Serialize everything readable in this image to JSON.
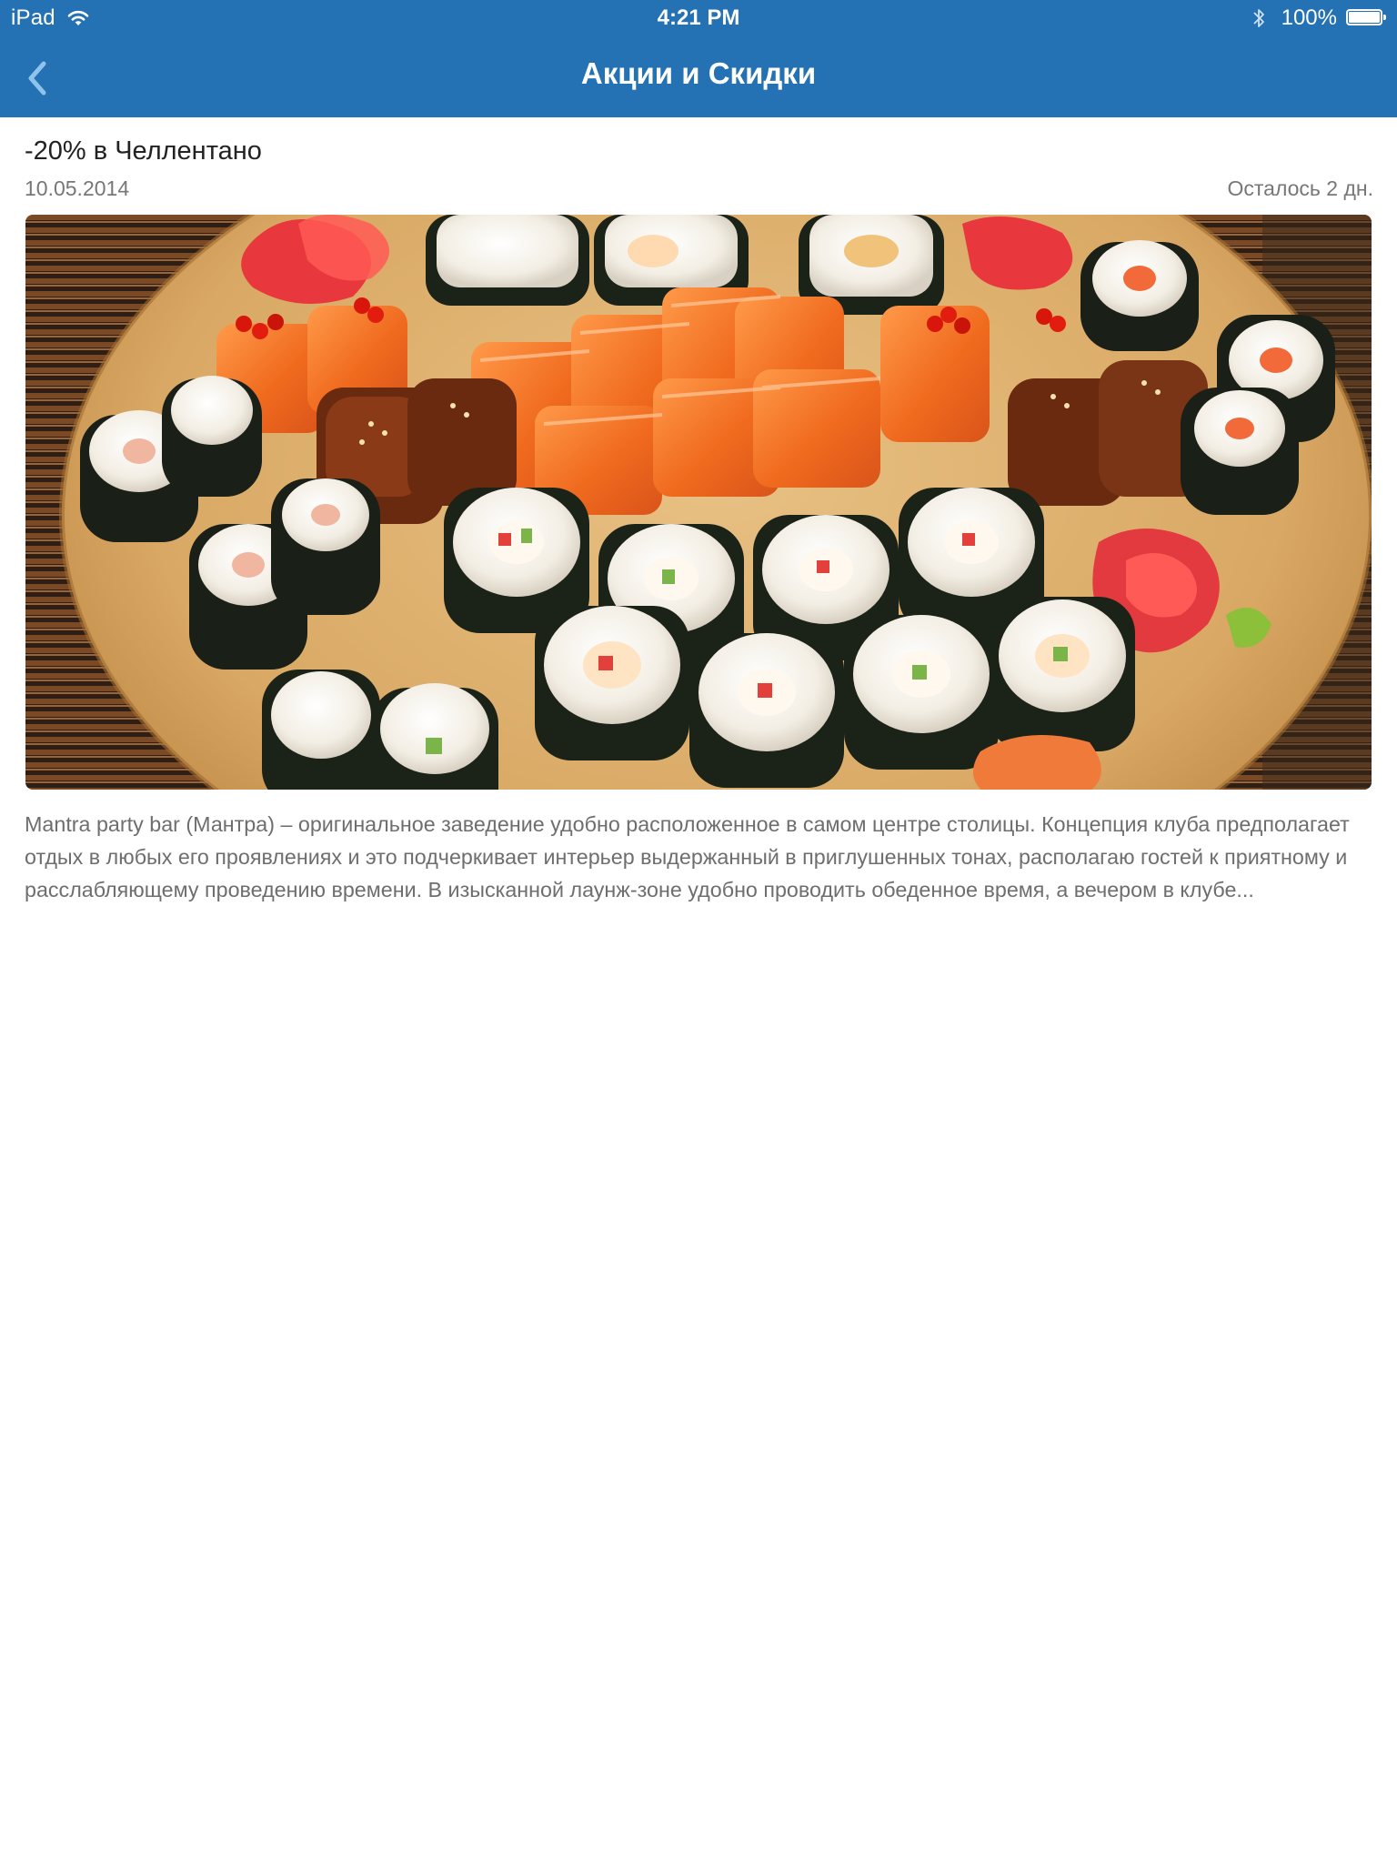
{
  "status_bar": {
    "carrier": "iPad",
    "time": "4:21 PM",
    "battery_percent": "100%",
    "icons": [
      "wifi-icon",
      "bluetooth-icon",
      "battery-icon"
    ]
  },
  "nav_bar": {
    "title": "Акции и Скидки",
    "back_icon": "chevron-left-icon"
  },
  "promo": {
    "title": "-20% в Челлентано",
    "date": "10.05.2014",
    "remaining": "Осталось 2 дн.",
    "image_subject": "sushi-platter",
    "description": "Mantra party bar (Мантра) – оригинальное заведение удобно расположенное в самом центре столицы. Концепция клуба предполагает отдых в любых его проявлениях и это подчеркивает интерьер выдержанный в приглушенных тонах, располагаю гостей к приятному и расслабляющему проведению времени. В изысканной лаунж-зоне удобно проводить обеденное время, а вечером в клубе..."
  },
  "colors": {
    "accent": "#2471b3",
    "back_chevron": "#8fc3ec",
    "text_primary": "#222222",
    "text_secondary": "#777777"
  }
}
